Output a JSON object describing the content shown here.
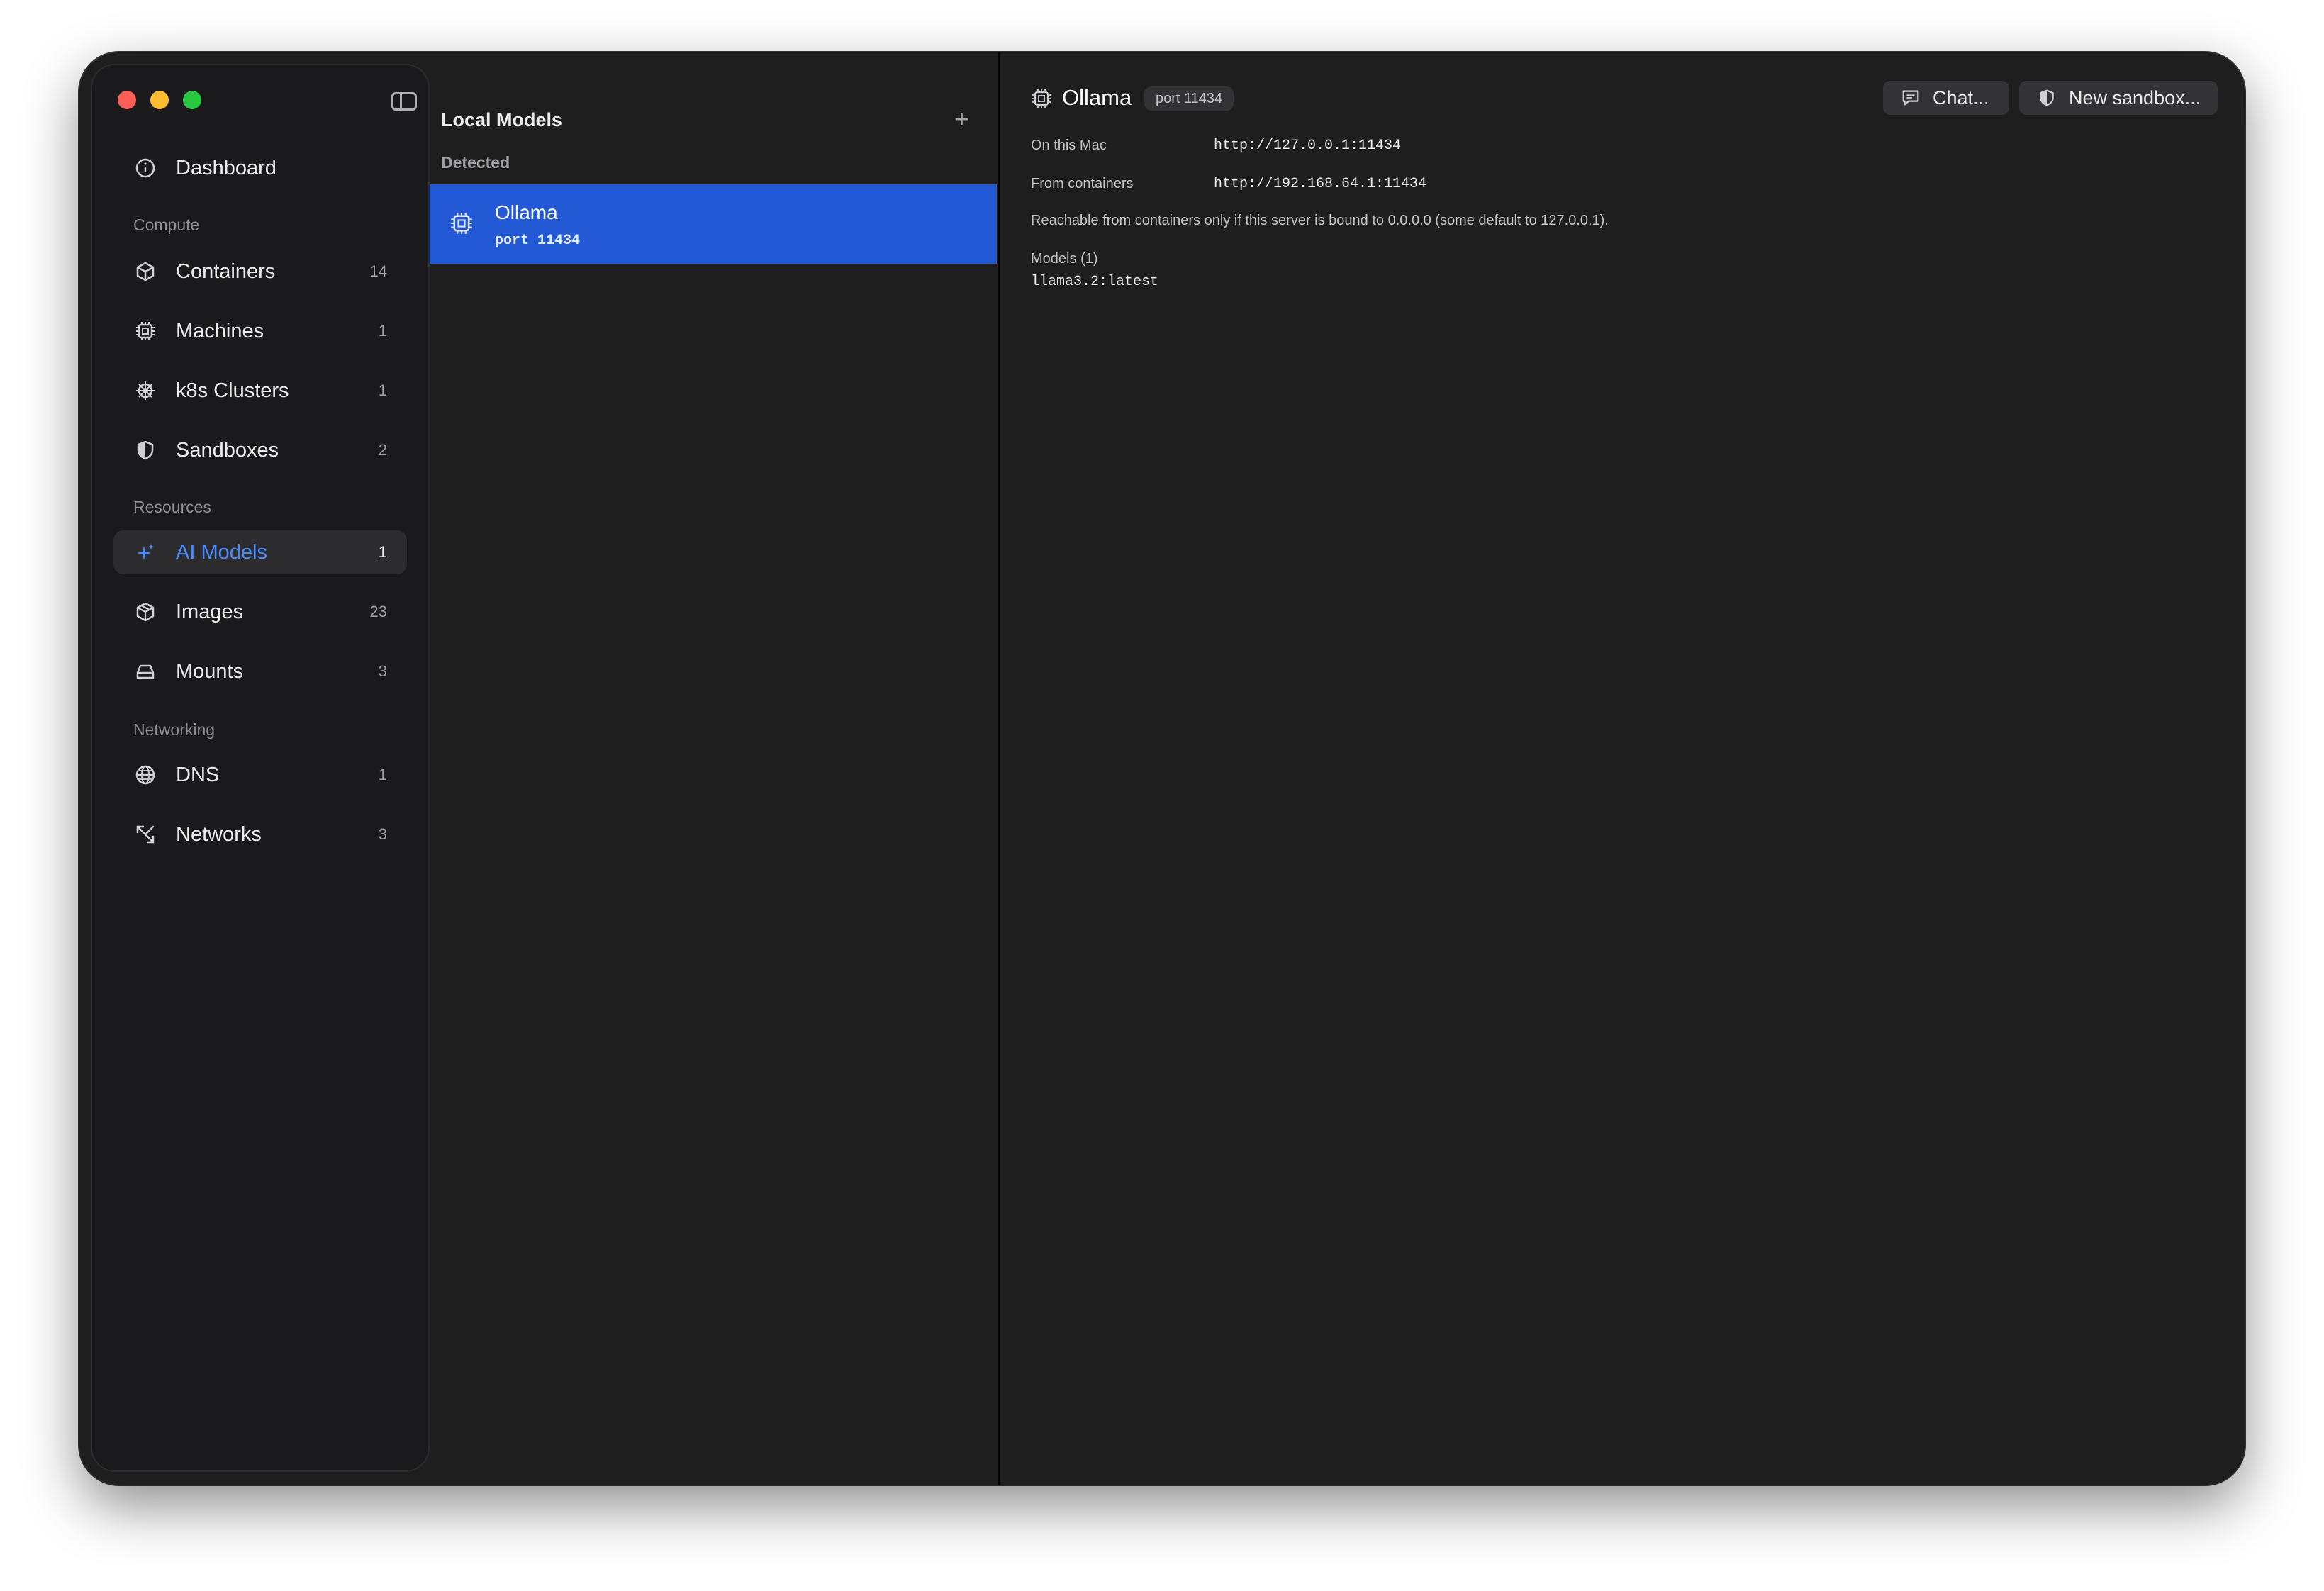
{
  "window": {
    "traffic_lights": {
      "close": "#ff5f57",
      "minimize": "#febc2e",
      "zoom": "#28c840"
    }
  },
  "sidebar": {
    "sections": {
      "compute": "Compute",
      "resources": "Resources",
      "networking": "Networking"
    },
    "items": [
      {
        "label": "Dashboard",
        "count": "",
        "icon": "info-circle-icon"
      },
      {
        "label": "Containers",
        "count": "14",
        "icon": "cube-icon"
      },
      {
        "label": "Machines",
        "count": "1",
        "icon": "cpu-icon"
      },
      {
        "label": "k8s Clusters",
        "count": "1",
        "icon": "helm-wheel-icon"
      },
      {
        "label": "Sandboxes",
        "count": "2",
        "icon": "shield-icon"
      },
      {
        "label": "AI Models",
        "count": "1",
        "icon": "sparkles-icon",
        "active": true
      },
      {
        "label": "Images",
        "count": "23",
        "icon": "box-icon"
      },
      {
        "label": "Mounts",
        "count": "3",
        "icon": "drive-icon"
      },
      {
        "label": "DNS",
        "count": "1",
        "icon": "globe-icon"
      },
      {
        "label": "Networks",
        "count": "3",
        "icon": "arrows-icon"
      }
    ],
    "accent": "#4a8cff"
  },
  "list": {
    "title": "Local Models",
    "section": "Detected",
    "rows": [
      {
        "name": "Ollama",
        "sub": "port 11434",
        "selected": true
      }
    ]
  },
  "detail": {
    "title": "Ollama",
    "port_badge": "port 11434",
    "chat_button": "Chat...",
    "sandbox_button": "New sandbox...",
    "on_this_mac_label": "On this Mac",
    "on_this_mac_value": "http://127.0.0.1:11434",
    "from_containers_label": "From containers",
    "from_containers_value": "http://192.168.64.1:11434",
    "note": "Reachable from containers only if this server is bound to 0.0.0.0 (some default to 127.0.0.1).",
    "models_title": "Models (1)",
    "models": [
      "llama3.2:latest"
    ]
  },
  "selection_color": "#2459d6"
}
